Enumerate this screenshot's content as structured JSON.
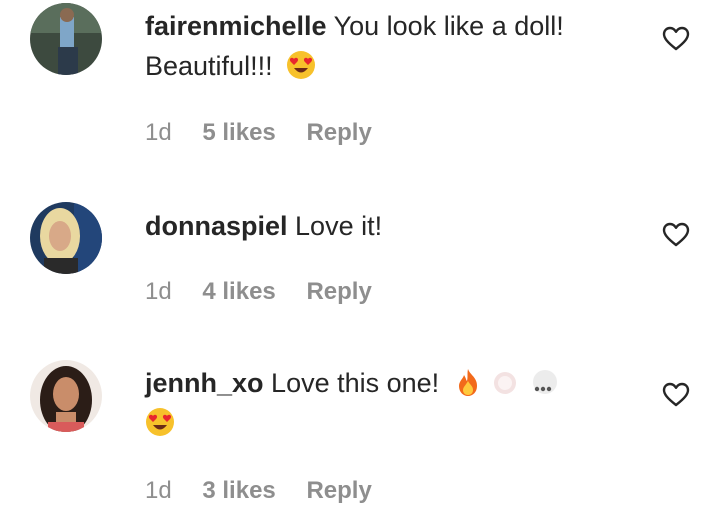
{
  "comments": [
    {
      "username": "fairenmichelle",
      "text": "You look like a doll! Beautiful!!!",
      "emoji": "heart-eyes-emoji",
      "time": "1d",
      "likes": "5 likes",
      "reply": "Reply"
    },
    {
      "username": "donnaspiel",
      "text": "Love it!",
      "time": "1d",
      "likes": "4 likes",
      "reply": "Reply"
    },
    {
      "username": "jennh_xo",
      "text": "Love this one!",
      "emoji": "fire-emoji",
      "emoji2": "heart-eyes-emoji",
      "time": "1d",
      "likes": "3 likes",
      "reply": "Reply"
    }
  ],
  "icons": {
    "like": "heart-outline-icon"
  },
  "colors": {
    "text": "#262626",
    "secondary": "#8e8e8e"
  }
}
